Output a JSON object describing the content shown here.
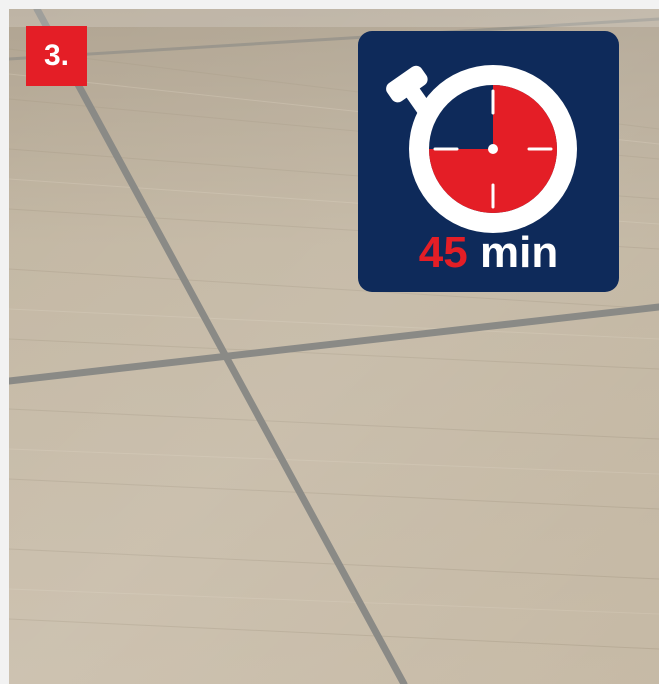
{
  "step": {
    "label": "3."
  },
  "timer": {
    "value": "45",
    "unit": "min",
    "elapsed_fraction": 0.75,
    "icon": "stopwatch-icon"
  },
  "colors": {
    "accent_red": "#e41e26",
    "card_navy": "#0e2a5a",
    "tile_beige": "#b9ab94",
    "grout": "#8a8a86"
  }
}
